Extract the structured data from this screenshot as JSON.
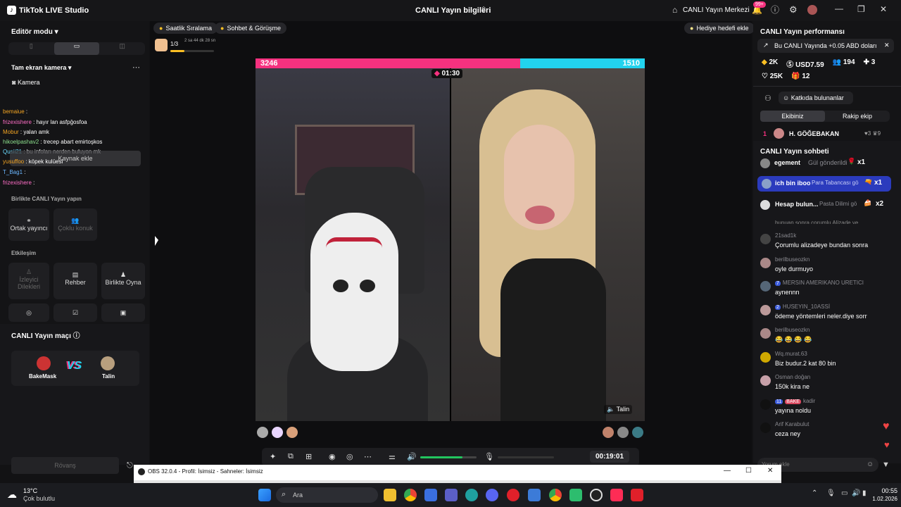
{
  "titlebar": {
    "app": "TikTok LIVE Studio",
    "center_title": "CANLI Yayın bilgileri",
    "center_link": "CANLI Yayın Merkezi",
    "notif_badge": "99+"
  },
  "left": {
    "editor_mode": "Editör modu",
    "camera_label": "Tam ekran kamera",
    "camera_item": "Kamera",
    "chat": [
      {
        "user": "bemaiue",
        "text": ""
      },
      {
        "user": "frizexishere",
        "text": "hayır lan asfpğosfoa"
      },
      {
        "user": "Mobur",
        "text": "yalan amk"
      },
      {
        "user": "hikoelpashav2",
        "text": "trecep abart emirtoşkos"
      },
      {
        "user": "Qusii21",
        "text": "bu infoları nerden buluyon mk"
      },
      {
        "user": "yusuffoo",
        "text": "köpek kulüesi"
      },
      {
        "user": "T_Bag1",
        "text": ""
      },
      {
        "user": "frizexishere",
        "text": ""
      }
    ],
    "add_source": "Kaynak ekle",
    "together_title": "Birlikte CANLI Yayın yapın",
    "cohost": "Ortak yayıncı",
    "multi_guest": "Çoklu konuk",
    "interaction_title": "Etkileşim",
    "viewer_wishes": "İzleyici Dilekleri",
    "guide": "Rehber",
    "play_together": "Birlikte Oyna",
    "match_title": "CANLI Yayın maçı",
    "player1": "BakeMask",
    "player2": "Talin",
    "vs": "VS",
    "rematch": "Rövanş"
  },
  "stage": {
    "hourly_rank": "Saatlik Sıralama",
    "chat_meet": "Sohbet & Görüşme",
    "gift_goal": "Hediye hedefi ekle",
    "goal_progress": "1/3",
    "goal_time": "2 sa 44 dk 28 sn",
    "score_left": "3246",
    "score_right": "1510",
    "timer": "01:30",
    "guest_name": "Talin",
    "elapsed": "00:19:01"
  },
  "right": {
    "perf_title": "CANLI Yayın performansı",
    "earnings_note": "Bu CANLI Yayında +0.05 ABD doları",
    "stats": {
      "likes": "2K",
      "usd": "USD7.59",
      "viewers": "194",
      "followers": "3",
      "hearts": "25K",
      "gifts": "12"
    },
    "contributors": "Katkıda bulunanlar",
    "tab_ours": "Ekibiniz",
    "tab_rival": "Rakip ekip",
    "top_rank": "1",
    "top_user": "H. GÖĞEBAKAN",
    "top_hearts": "3",
    "top_gifts": "9",
    "chat_title": "CANLI Yayın sohbeti",
    "gifts": [
      {
        "user": "egement",
        "action": "Gül gönderildi",
        "count": "x1"
      },
      {
        "user": "ich bin iboo",
        "action": "Para Tabancası gö",
        "count": "x1"
      },
      {
        "user": "Hesap bulun...",
        "action": "Pasta Dilimi gö",
        "count": "x2"
      }
    ],
    "partial_line": "bunuan sonra çorumlu Alizade ye",
    "comments": [
      {
        "user": "21sad1k",
        "badge": "",
        "text": "Çorumlu alizadeye bundan sonra"
      },
      {
        "user": "berilbuseozkn",
        "badge": "",
        "text": "oyle durmuyo"
      },
      {
        "user": "MERSIN AMERIKANO URETICI",
        "badge": "7",
        "text": "aynennn"
      },
      {
        "user": "HUSEYIN_10ASSİ",
        "badge": "2",
        "text": "ödeme yöntemleri neler.diye sorr"
      },
      {
        "user": "berilbuseozkn",
        "badge": "",
        "text": "😂 😂 😂 😂"
      },
      {
        "user": "Wq.murat.63",
        "badge": "",
        "text": "Biz budur.2 kat 80 bin"
      },
      {
        "user": "Osman doğan",
        "badge": "",
        "text": "150k kira ne"
      },
      {
        "user": "kadir",
        "badge": "11",
        "badge2": "BAKE",
        "text": "yayına noldu"
      },
      {
        "user": "Arif Karabulut",
        "badge": "",
        "text": "ceza ney"
      }
    ],
    "comment_placeholder": "Yorum ekle"
  },
  "obs": {
    "title": "OBS 32.0.4 - Profil: İsimsiz - Sahneler: İsimsiz"
  },
  "taskbar": {
    "temp": "13°C",
    "weather": "Çok bulutlu",
    "search": "Ara",
    "time": "00:55",
    "date": "1.02.2026"
  },
  "colors": {
    "pink": "#f5317f",
    "cyan": "#22d3ee",
    "green": "#22c55e"
  }
}
